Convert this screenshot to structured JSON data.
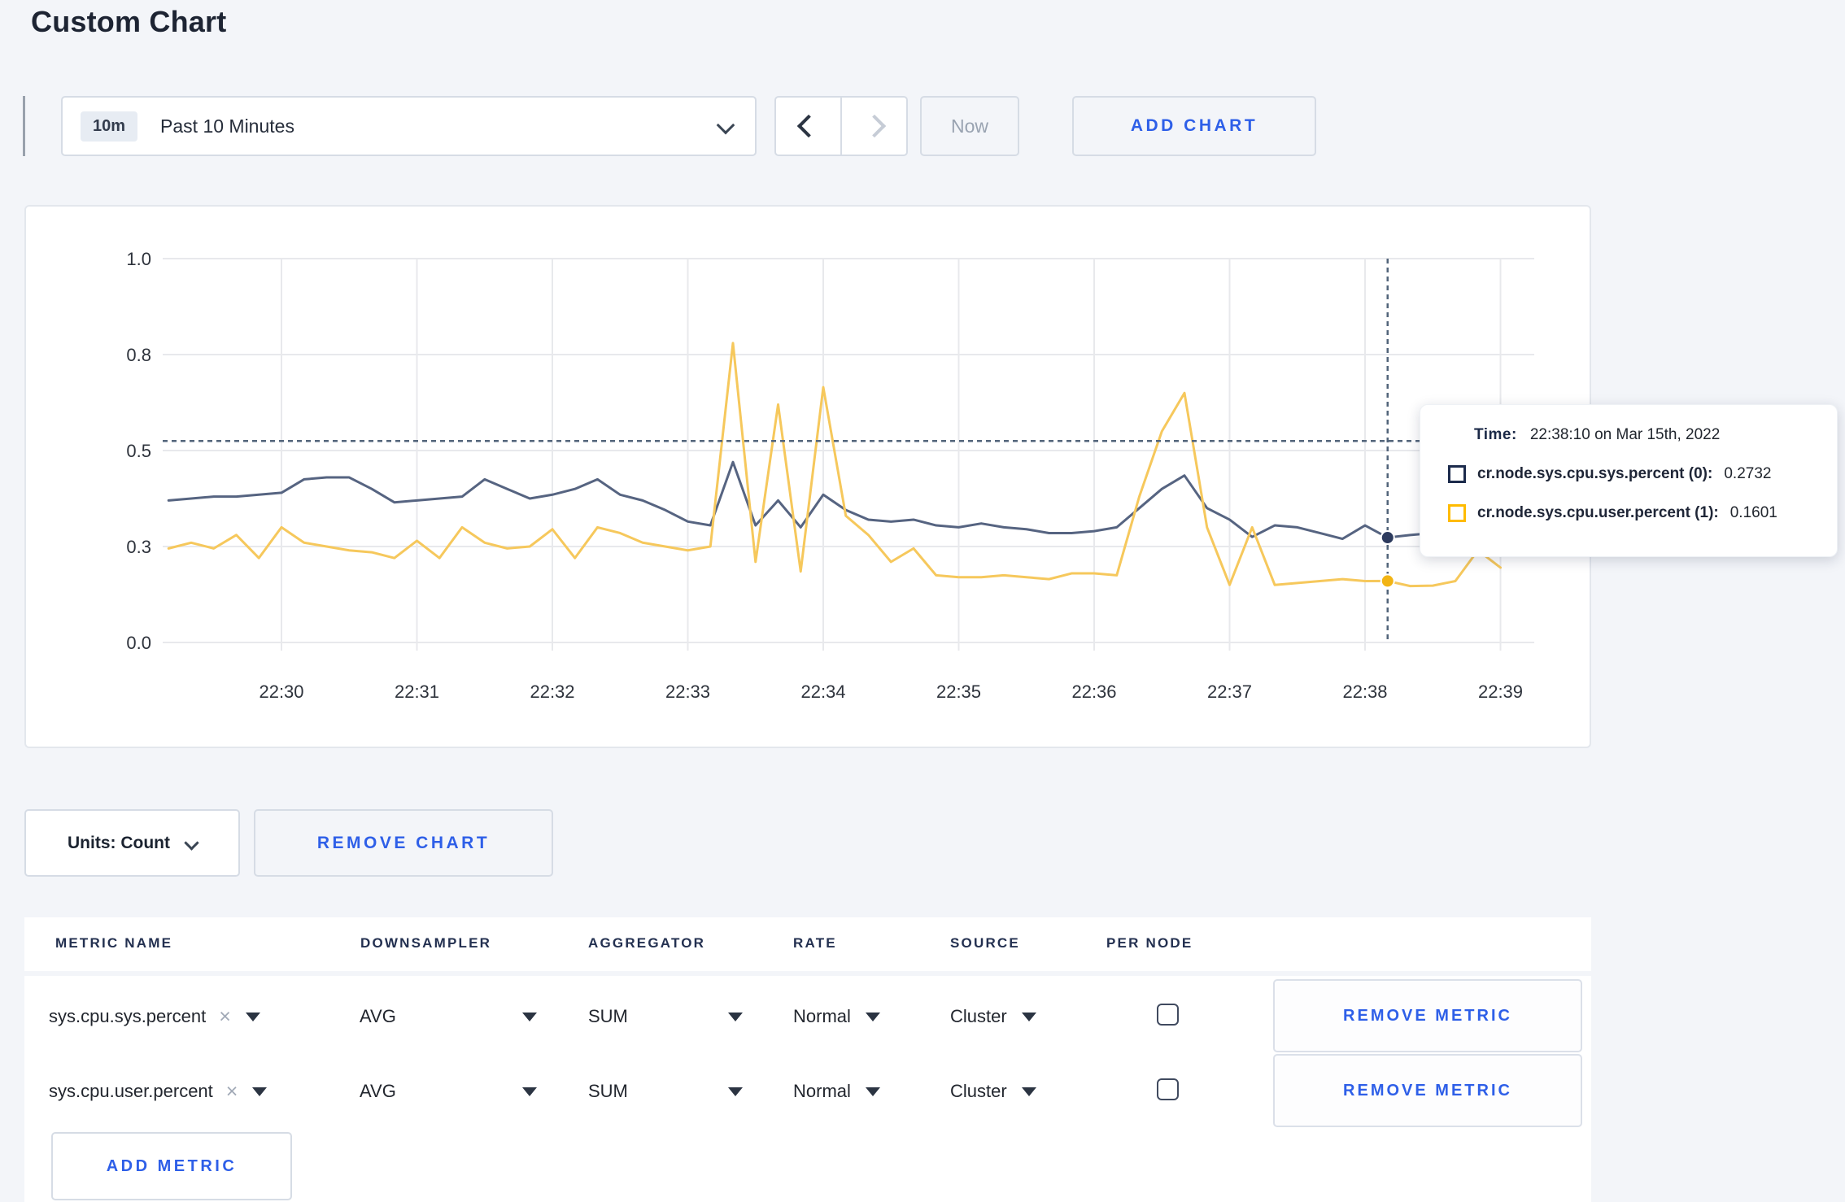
{
  "page_title": "Custom Chart",
  "toolbar": {
    "range_badge": "10m",
    "range_label": "Past 10 Minutes",
    "now_label": "Now",
    "add_chart_label": "ADD CHART"
  },
  "units": {
    "label": "Units: Count",
    "remove_chart_label": "REMOVE CHART"
  },
  "tooltip": {
    "time_label": "Time:",
    "time_value": "22:38:10 on Mar 15th, 2022",
    "rows": [
      {
        "name": "cr.node.sys.cpu.sys.percent (0):",
        "value": "0.2732",
        "color": "#1c2b4c"
      },
      {
        "name": "cr.node.sys.cpu.user.percent (1):",
        "value": "0.1601",
        "color": "#ffbb00"
      }
    ]
  },
  "chart_data": {
    "type": "line",
    "title": "",
    "xlabel": "",
    "ylabel": "",
    "ylim": [
      0,
      1
    ],
    "grid": true,
    "legend_position": "tooltip",
    "x_ticks": [
      "22:30",
      "22:31",
      "22:32",
      "22:33",
      "22:34",
      "22:35",
      "22:36",
      "22:37",
      "22:38",
      "22:39"
    ],
    "y_ticks": [
      "0.0",
      "0.3",
      "0.5",
      "0.8",
      "1.0"
    ],
    "y_tick_values": [
      0,
      0.25,
      0.5,
      0.75,
      1.0
    ],
    "x_start": "22:29:10",
    "x_step_seconds": 10,
    "times": [
      "22:29:10",
      "22:29:20",
      "22:29:30",
      "22:29:40",
      "22:29:50",
      "22:30:00",
      "22:30:10",
      "22:30:20",
      "22:30:30",
      "22:30:40",
      "22:30:50",
      "22:31:00",
      "22:31:10",
      "22:31:20",
      "22:31:30",
      "22:31:40",
      "22:31:50",
      "22:32:00",
      "22:32:10",
      "22:32:20",
      "22:32:30",
      "22:32:40",
      "22:32:50",
      "22:33:00",
      "22:33:10",
      "22:33:20",
      "22:33:30",
      "22:33:40",
      "22:33:50",
      "22:34:00",
      "22:34:10",
      "22:34:20",
      "22:34:30",
      "22:34:40",
      "22:34:50",
      "22:35:00",
      "22:35:10",
      "22:35:20",
      "22:35:30",
      "22:35:40",
      "22:35:50",
      "22:36:00",
      "22:36:10",
      "22:36:20",
      "22:36:30",
      "22:36:40",
      "22:36:50",
      "22:37:00",
      "22:37:10",
      "22:37:20",
      "22:37:30",
      "22:37:40",
      "22:37:50",
      "22:38:00",
      "22:38:10",
      "22:38:20",
      "22:38:30",
      "22:38:40",
      "22:38:50",
      "22:39:00"
    ],
    "series": [
      {
        "name": "cr.node.sys.cpu.sys.percent",
        "color": "#566481",
        "dot_color": "#2d3b5e",
        "values": [
          0.37,
          0.375,
          0.38,
          0.38,
          0.385,
          0.39,
          0.425,
          0.43,
          0.43,
          0.4,
          0.365,
          0.37,
          0.375,
          0.38,
          0.425,
          0.4,
          0.375,
          0.385,
          0.4,
          0.425,
          0.385,
          0.37,
          0.345,
          0.315,
          0.305,
          0.47,
          0.305,
          0.37,
          0.3,
          0.385,
          0.345,
          0.32,
          0.315,
          0.32,
          0.305,
          0.3,
          0.31,
          0.3,
          0.295,
          0.285,
          0.285,
          0.29,
          0.3,
          0.35,
          0.4,
          0.435,
          0.35,
          0.32,
          0.275,
          0.305,
          0.3,
          0.285,
          0.27,
          0.305,
          0.2732,
          0.28,
          0.285,
          0.28,
          0.29,
          0.3
        ]
      },
      {
        "name": "cr.node.sys.cpu.user.percent",
        "color": "#f6c85c",
        "dot_color": "#f2b414",
        "values": [
          0.245,
          0.26,
          0.245,
          0.28,
          0.22,
          0.3,
          0.26,
          0.25,
          0.24,
          0.235,
          0.22,
          0.265,
          0.22,
          0.3,
          0.26,
          0.245,
          0.25,
          0.295,
          0.22,
          0.3,
          0.285,
          0.26,
          0.25,
          0.24,
          0.25,
          0.78,
          0.21,
          0.62,
          0.185,
          0.665,
          0.33,
          0.28,
          0.21,
          0.245,
          0.175,
          0.17,
          0.17,
          0.175,
          0.17,
          0.165,
          0.18,
          0.18,
          0.175,
          0.38,
          0.55,
          0.65,
          0.3,
          0.15,
          0.3,
          0.15,
          0.155,
          0.16,
          0.165,
          0.16,
          0.1601,
          0.147,
          0.148,
          0.16,
          0.24,
          0.195
        ]
      }
    ],
    "crosshair": {
      "time": "22:38:10",
      "x_index": 54,
      "y_value": 0.525
    },
    "colors": {
      "grid": "#e8e9ec",
      "tick_text": "#2e333c",
      "crosshair": "#53657b"
    }
  },
  "metrics": {
    "columns": [
      "METRIC NAME",
      "DOWNSAMPLER",
      "AGGREGATOR",
      "RATE",
      "SOURCE",
      "PER NODE"
    ],
    "rows": [
      {
        "name": "sys.cpu.sys.percent",
        "clear": "×",
        "downsampler": "AVG",
        "aggregator": "SUM",
        "rate": "Normal",
        "source": "Cluster",
        "per_node_checked": false,
        "remove_label": "REMOVE METRIC"
      },
      {
        "name": "sys.cpu.user.percent",
        "clear": "×",
        "downsampler": "AVG",
        "aggregator": "SUM",
        "rate": "Normal",
        "source": "Cluster",
        "per_node_checked": false,
        "remove_label": "REMOVE METRIC"
      }
    ],
    "add_metric_label": "ADD METRIC"
  }
}
